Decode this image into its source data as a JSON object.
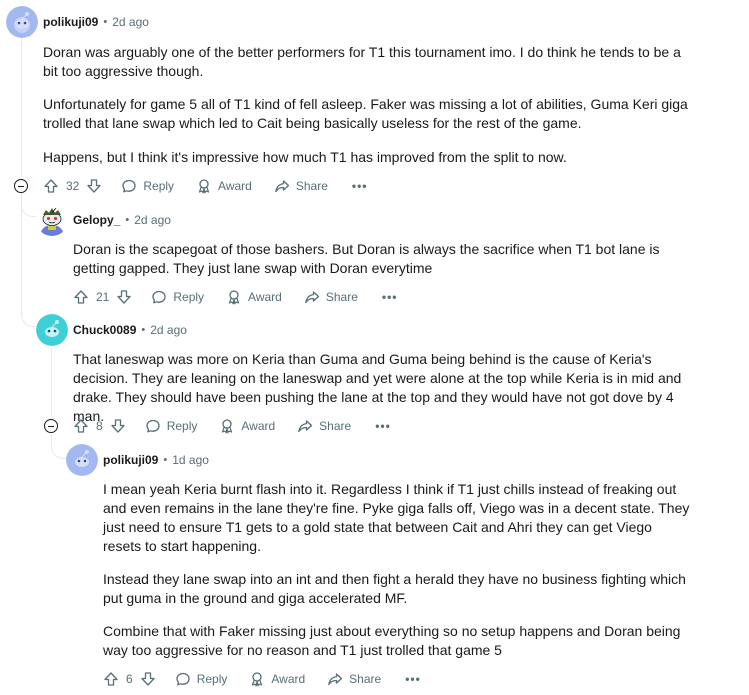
{
  "comments": [
    {
      "username": "polikuji09",
      "time": "2d ago",
      "paragraphs": [
        "Doran was arguably one of the better performers for T1 this tournament imo. I do think he tends to be a bit too aggressive though.",
        "Unfortunately for game 5 all of T1 kind of fell asleep. Faker was missing a lot of abilities, Guma Keri giga trolled that lane swap which led to Cait being basically useless for the rest of the game.",
        "Happens, but I think it's impressive how much T1 has improved from the split to now."
      ],
      "votes": "32"
    },
    {
      "username": "Gelopy_",
      "time": "2d ago",
      "paragraphs": [
        "Doran is the scapegoat of those bashers. But Doran is always the sacrifice when T1 bot lane is getting gapped. They just lane swap with Doran everytime"
      ],
      "votes": "21"
    },
    {
      "username": "Chuck0089",
      "time": "2d ago",
      "paragraphs": [
        "That laneswap was more on Keria than Guma and Guma being behind is the cause of Keria's decision. They are leaning on the laneswap and yet were alone at the top while Keria is in mid and drake. They should have been pushing the lane at the top and they would have not got dove by 4 man."
      ],
      "votes": "8"
    },
    {
      "username": "polikuji09",
      "time": "1d ago",
      "paragraphs": [
        "I mean yeah Keria burnt flash into it. Regardless I think if T1 just chills instead of freaking out and even remains in the lane they're fine. Pyke giga falls off, Viego was in a decent state. They just need to ensure T1 gets to a gold state that between Cait and Ahri they can get Viego resets to start happening.",
        "Instead they lane swap into an int and then fight a herald they have no business fighting which put guma in the ground and giga accelerated MF.",
        "Combine that with Faker missing just about everything so no setup happens and Doran being way too aggressive for no reason and T1 just trolled that game 5"
      ],
      "votes": "6"
    }
  ],
  "labels": {
    "dot": "•",
    "reply": "Reply",
    "award": "Award",
    "share": "Share",
    "more": "•••"
  },
  "icons": {
    "upvote": "upvote-icon",
    "downvote": "downvote-icon",
    "reply": "comment-bubble-icon",
    "award": "award-icon",
    "share": "share-icon",
    "more": "more-dots-icon",
    "collapse": "collapse-minus-icon"
  },
  "colors": {
    "text": "#1a1a1b",
    "meta": "#576f76",
    "thread": "#e5ebee",
    "avatar_blue": "#a3b8f0",
    "avatar_teal": "#3ed0d6"
  }
}
